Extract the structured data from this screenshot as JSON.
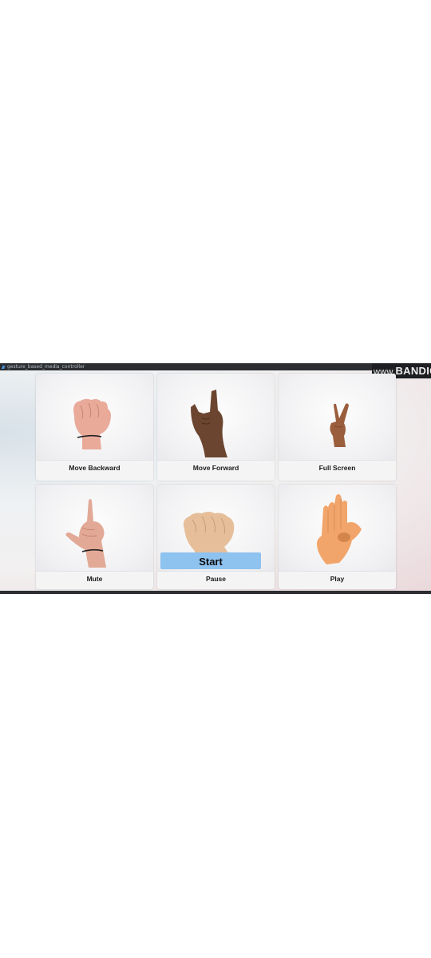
{
  "window": {
    "title": "gesture_based_media_controller",
    "watermark": {
      "prefix": "www.",
      "brand": "BANDICAM"
    }
  },
  "gestures": [
    {
      "label": "Move Backward",
      "icon": "fist-hand-icon",
      "skin": "#e9aa9a"
    },
    {
      "label": "Move Forward",
      "icon": "rock-hand-icon",
      "skin": "#6b4530"
    },
    {
      "label": "Full Screen",
      "icon": "peace-hand-icon",
      "skin": "#9b5e3d"
    },
    {
      "label": "Mute",
      "icon": "pointing-up-hand-icon",
      "skin": "#e2a996"
    },
    {
      "label": "Pause",
      "icon": "closed-fist-hand-icon",
      "skin": "#e6bf9a"
    },
    {
      "label": "Play",
      "icon": "ok-hand-icon",
      "skin": "#f2a56a"
    }
  ],
  "start_button": {
    "label": "Start",
    "color": "#8ec2ef"
  }
}
